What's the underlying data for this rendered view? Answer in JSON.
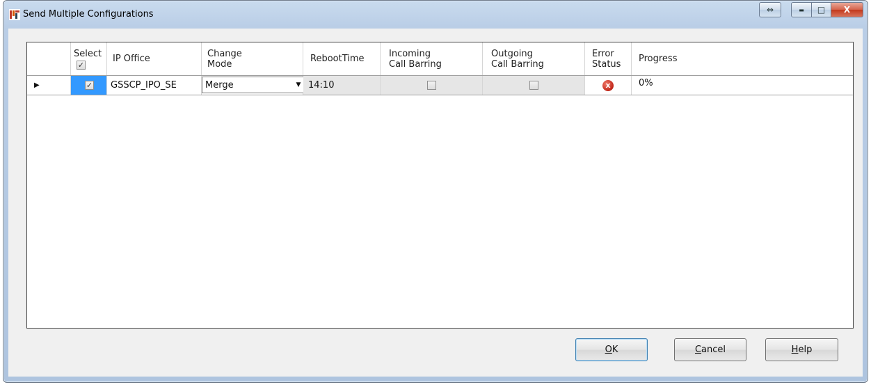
{
  "window": {
    "title": "Send Multiple Configurations",
    "icon": "avaya-manager-icon",
    "caption_buttons": {
      "resize": "⇔",
      "minimize": "▬",
      "maximize": "□",
      "close": "X"
    }
  },
  "grid": {
    "columns": {
      "select": {
        "label": "Select",
        "header_checkbox": "✓"
      },
      "ip_office": "IP Office",
      "change_mode": {
        "line1": "Change",
        "line2": "Mode"
      },
      "reboot_time": "RebootTime",
      "incoming": {
        "line1": "Incoming",
        "line2": "Call Barring"
      },
      "outgoing": {
        "line1": "Outgoing",
        "line2": "Call Barring"
      },
      "error_status": {
        "line1": "Error",
        "line2": "Status"
      },
      "progress": "Progress"
    },
    "rows": [
      {
        "row_indicator": "▶",
        "selected": "✓",
        "ip_office": "GSSCP_IPO_SE",
        "change_mode": "Merge",
        "reboot_time": "14:10",
        "incoming_call_barring": "",
        "outgoing_call_barring": "",
        "error_icon": "x",
        "progress": "0%"
      }
    ]
  },
  "buttons": {
    "ok": {
      "mnemonic": "O",
      "rest": "K"
    },
    "cancel": {
      "mnemonic": "C",
      "rest": "ancel"
    },
    "help": {
      "mnemonic": "H",
      "rest": "elp"
    }
  },
  "colors": {
    "select_cell_highlight": "#3399ff",
    "error": "#c1271a"
  }
}
